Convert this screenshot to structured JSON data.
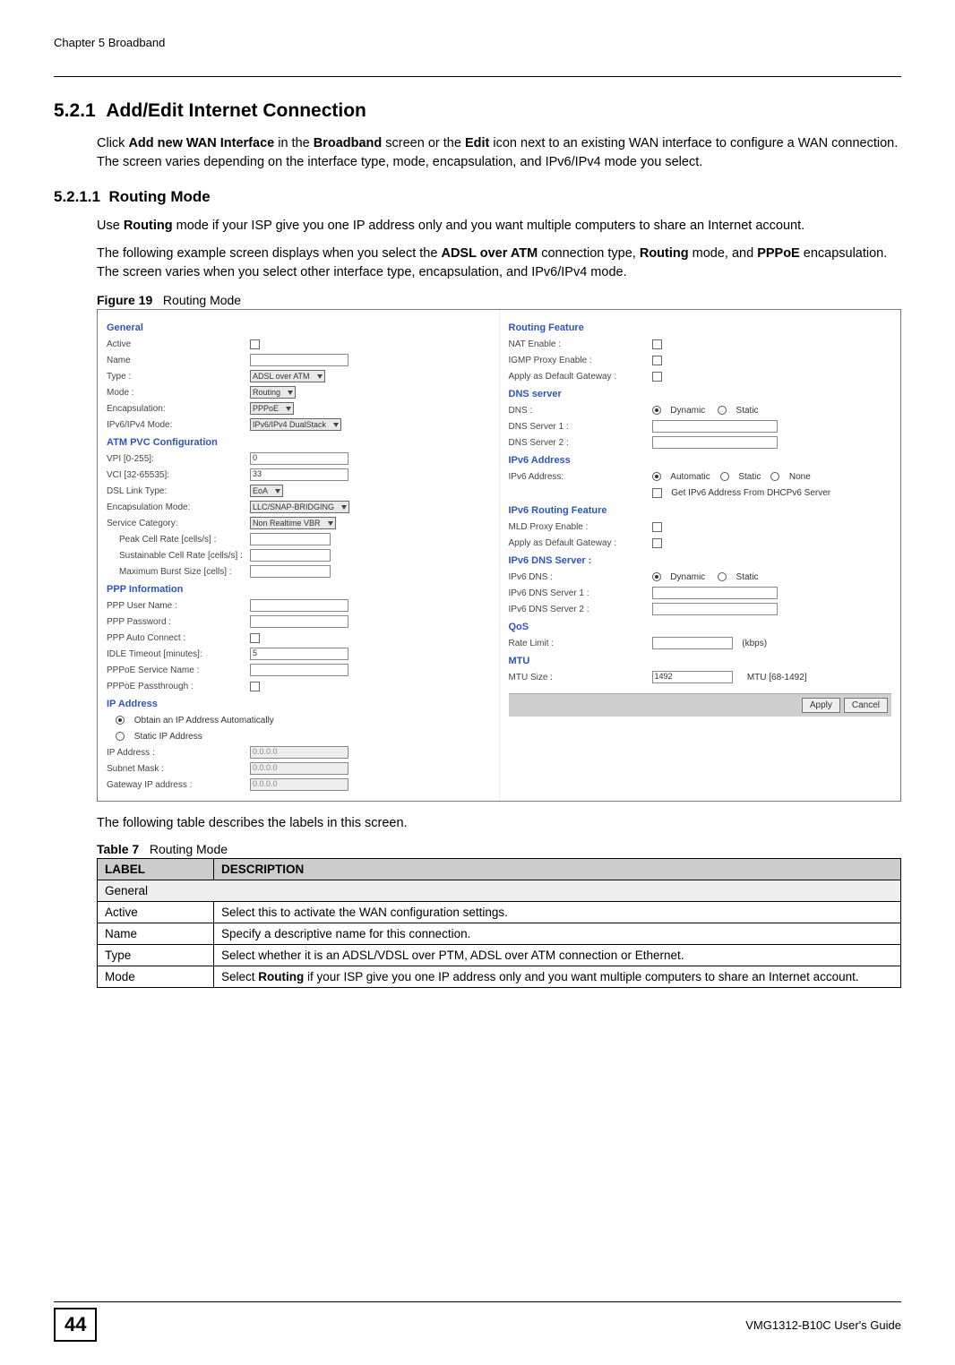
{
  "runhead": "Chapter 5 Broadband",
  "section": {
    "num": "5.2.1",
    "title": "Add/Edit Internet Connection",
    "p1a": "Click ",
    "p1b": "Add new WAN Interface",
    "p1c": " in the ",
    "p1d": "Broadband",
    "p1e": " screen or the ",
    "p1f": "Edit",
    "p1g": " icon next to an existing WAN interface to configure a WAN connection. The screen varies depending on the interface type, mode, encapsulation, and IPv6/IPv4 mode you select."
  },
  "sub": {
    "num": "5.2.1.1",
    "title": "Routing Mode",
    "p1a": "Use ",
    "p1b": "Routing",
    "p1c": " mode if your ISP give you one IP address only and you want multiple computers to share an Internet account.",
    "p2a": "The following example screen displays when you select the ",
    "p2b": "ADSL over ATM",
    "p2c": " connection type, ",
    "p2d": "Routing",
    "p2e": " mode, and ",
    "p2f": "PPPoE",
    "p2g": " encapsulation. The screen varies when you select other interface type, encapsulation, and IPv6/IPv4 mode."
  },
  "figcap_pre": "Figure 19",
  "figcap": "Routing Mode",
  "ss": {
    "left": {
      "general": "General",
      "active": "Active",
      "name": "Name",
      "type": "Type :",
      "type_val": "ADSL over ATM",
      "mode": "Mode :",
      "mode_val": "Routing",
      "encap": "Encapsulation:",
      "encap_val": "PPPoE",
      "ipmode": "IPv6/IPv4 Mode:",
      "ipmode_val": "IPv6/IPv4 DualStack",
      "atm_hdr": "ATM PVC Configuration",
      "vpi": "VPI [0-255]:",
      "vpi_val": "0",
      "vci": "VCI [32-65535]:",
      "vci_val": "33",
      "dsl": "DSL Link Type:",
      "dsl_val": "EoA",
      "encm": "Encapsulation Mode:",
      "encm_val": "LLC/SNAP-BRIDGING",
      "svc": "Service Category:",
      "svc_val": "Non Realtime VBR",
      "peak": "Peak Cell Rate [cells/s] :",
      "sust": "Sustainable Cell Rate [cells/s] :",
      "burst": "Maximum Burst Size [cells] :",
      "ppp_hdr": "PPP Information",
      "pppu": "PPP User Name :",
      "pppp": "PPP Password :",
      "pppa": "PPP Auto Connect :",
      "idle": "IDLE Timeout [minutes]:",
      "idle_val": "5",
      "pppn": "PPPoE Service Name :",
      "pppt": "PPPoE Passthrough :",
      "ip_hdr": "IP Address",
      "ipauto": "Obtain an IP Address Automatically",
      "ipstatic": "Static IP Address",
      "ipaddr": "IP Address :",
      "zero": "0.0.0.0",
      "mask": "Subnet Mask :",
      "gw": "Gateway IP address :"
    },
    "right": {
      "rf_hdr": "Routing Feature",
      "nat": "NAT Enable :",
      "igmp": "IGMP Proxy Enable :",
      "gwdef": "Apply as Default Gateway :",
      "dns_hdr": "DNS server",
      "dns": "DNS :",
      "dyn": "Dynamic",
      "stat": "Static",
      "dns1": "DNS Server 1 :",
      "dns2": "DNS Server 2 :",
      "v6a_hdr": "IPv6 Address",
      "v6a": "IPv6 Address:",
      "auto": "Automatic",
      "none": "None",
      "getdhcp": "Get IPv6 Address From DHCPv6 Server",
      "v6r_hdr": "IPv6 Routing Feature",
      "mld": "MLD Proxy Enable :",
      "v6gw": "Apply as Default Gateway :",
      "v6d_hdr": "IPv6 DNS Server :",
      "v6dns": "IPv6 DNS :",
      "v6dns1": "IPv6 DNS Server 1 :",
      "v6dns2": "IPv6 DNS Server 2 :",
      "qos_hdr": "QoS",
      "rate": "Rate Limit :",
      "kbps": "(kbps)",
      "mtu_hdr": "MTU",
      "mtu": "MTU Size :",
      "mtu_val": "1492",
      "mtu_range": "MTU [68-1492]",
      "apply": "Apply",
      "cancel": "Cancel"
    }
  },
  "after_fig": "The following table describes the labels in this screen.",
  "tbl_pre": "Table 7",
  "tbl_cap": "Routing Mode",
  "tbl_h1": "LABEL",
  "tbl_h2": "DESCRIPTION",
  "tbl": {
    "r0": "General",
    "r1l": "Active",
    "r1d": "Select this to activate the WAN configuration settings.",
    "r2l": "Name",
    "r2d": "Specify a descriptive name for this connection.",
    "r3l": "Type",
    "r3d": "Select whether it is an ADSL/VDSL over PTM, ADSL over ATM connection or Ethernet.",
    "r4l": "Mode",
    "r4da": "Select ",
    "r4db": "Routing",
    "r4dc": " if your ISP give you one IP address only and you want multiple computers to share an Internet account."
  },
  "foot": {
    "page": "44",
    "title": "VMG1312-B10C User's Guide"
  }
}
